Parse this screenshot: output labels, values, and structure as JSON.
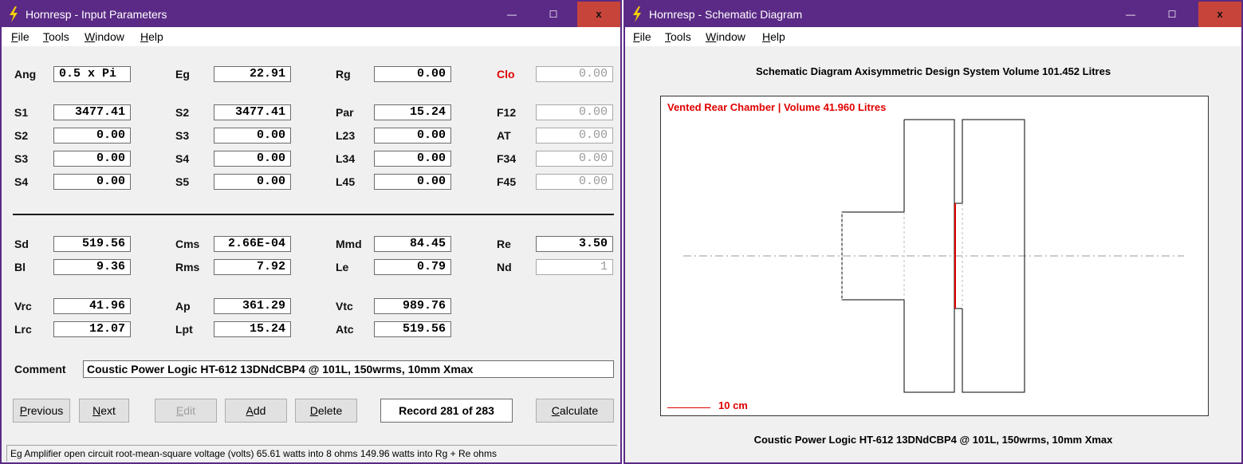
{
  "left_window": {
    "title": "Hornresp - Input Parameters",
    "controls": {
      "minimize": "—",
      "maximize": "☐",
      "close": "x"
    },
    "menu": [
      "File",
      "Tools",
      "Window",
      "Help"
    ],
    "params": {
      "Ang": "0.5 x Pi",
      "Eg": "22.91",
      "Rg": "0.00",
      "Clo": "0.00",
      "S1": "3477.41",
      "S2a": "3477.41",
      "Par": "15.24",
      "F12": "0.00",
      "S2": "0.00",
      "S3a": "0.00",
      "L23": "0.00",
      "AT": "0.00",
      "S3": "0.00",
      "S4a": "0.00",
      "L34": "0.00",
      "F34": "0.00",
      "S4": "0.00",
      "S5": "0.00",
      "L45": "0.00",
      "F45": "0.00",
      "Sd": "519.56",
      "Cms": "2.66E-04",
      "Mmd": "84.45",
      "Re": "3.50",
      "Bl": "9.36",
      "Rms": "7.92",
      "Le": "0.79",
      "Nd": "1",
      "Vrc": "41.96",
      "Ap": "361.29",
      "Vtc": "989.76",
      "Lrc": "12.07",
      "Lpt": "15.24",
      "Atc": "519.56"
    },
    "labels": {
      "Ang": "Ang",
      "Eg": "Eg",
      "Rg": "Rg",
      "Clo": "Clo",
      "S1": "S1",
      "S2a": "S2",
      "Par": "Par",
      "F12": "F12",
      "S2": "S2",
      "S3a": "S3",
      "L23": "L23",
      "AT": "AT",
      "S3": "S3",
      "S4a": "S4",
      "L34": "L34",
      "F34": "F34",
      "S4": "S4",
      "S5": "S5",
      "L45": "L45",
      "F45": "F45",
      "Sd": "Sd",
      "Cms": "Cms",
      "Mmd": "Mmd",
      "Re": "Re",
      "Bl": "Bl",
      "Rms": "Rms",
      "Le": "Le",
      "Nd": "Nd",
      "Vrc": "Vrc",
      "Ap": "Ap",
      "Vtc": "Vtc",
      "Lrc": "Lrc",
      "Lpt": "Lpt",
      "Atc": "Atc",
      "Comment": "Comment"
    },
    "comment": "Coustic Power Logic HT-612 13DNdCBP4 @ 101L, 150wrms, 10mm Xmax",
    "buttons": {
      "previous": "Previous",
      "next": "Next",
      "edit": "Edit",
      "add": "Add",
      "delete": "Delete",
      "calculate": "Calculate"
    },
    "record": "Record 281 of 283",
    "status": "Eg   Amplifier open circuit root-mean-square voltage  (volts)   65.61 watts into 8 ohms   149.96 watts into Rg + Re ohms"
  },
  "right_window": {
    "title": "Hornresp - Schematic Diagram",
    "controls": {
      "minimize": "—",
      "maximize": "☐",
      "close": "x"
    },
    "menu": [
      "File",
      "Tools",
      "Window",
      "Help"
    ],
    "header": "Schematic Diagram   Axisymmetric Design   System Volume 101.452 Litres",
    "caption": "Vented Rear Chamber | Volume 41.960 Litres",
    "scale": "10 cm",
    "footer": "Coustic Power Logic HT-612 13DNdCBP4 @ 101L, 150wrms, 10mm Xmax"
  },
  "colors": {
    "titlebar": "#5b2a86",
    "close": "#c7443a",
    "accent_red": "#e00000"
  },
  "icons": {
    "app": "lightning-bolt-icon"
  }
}
